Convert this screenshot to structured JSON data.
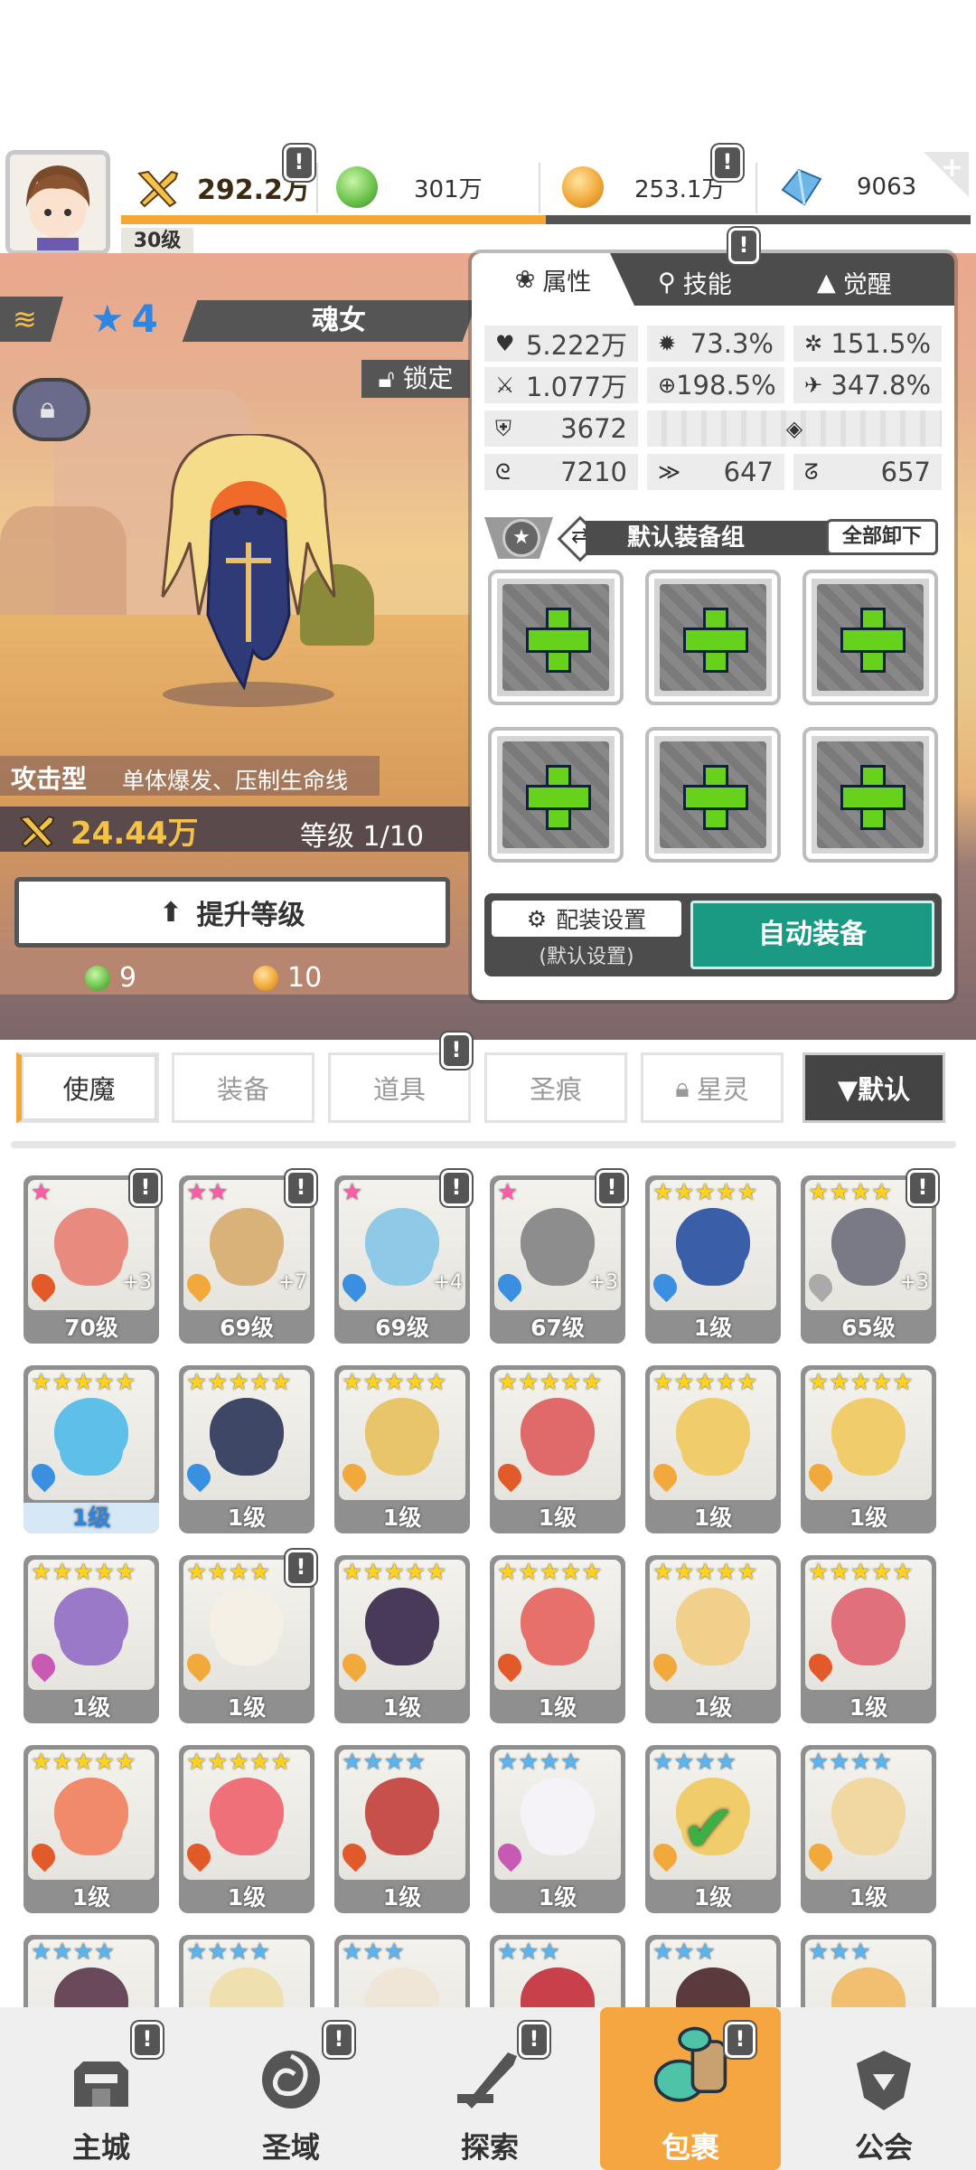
{
  "header": {
    "player_level": "30级",
    "power": "292.2万",
    "currencies": [
      {
        "name": "green-orb",
        "value": "301万",
        "color": "#6fc54f"
      },
      {
        "name": "gold-coin",
        "value": "253.1万",
        "color": "#f2a93b"
      },
      {
        "name": "blue-gem",
        "value": "9063",
        "color": "#6cb7e8"
      }
    ],
    "xp_progress": 0.5,
    "alert_mark": "!"
  },
  "hero": {
    "star_level": "4",
    "name": "魂女",
    "lock_label": "锁定",
    "type": "攻击型",
    "type_desc": "单体爆发、压制生命线",
    "power": "24.44万",
    "level": "等级 1/10",
    "upgrade_label": "提升等级",
    "costs": [
      {
        "value": "9",
        "color": "#6fc54f"
      },
      {
        "value": "10",
        "color": "#f2a93b"
      }
    ]
  },
  "panel": {
    "tabs": [
      "属性",
      "技能",
      "觉醒"
    ],
    "stats": [
      [
        "5.222万",
        "73.3%",
        "151.5%"
      ],
      [
        "1.077万",
        "198.5%",
        "347.8%"
      ],
      [
        "3672"
      ],
      [
        "7210",
        "647",
        "657"
      ]
    ],
    "equip_group": "默认装备组",
    "unequip_all": "全部卸下",
    "config_label": "配装设置",
    "config_sub": "(默认设置)",
    "auto_equip": "自动装备"
  },
  "tabs": {
    "items": [
      "使魔",
      "装备",
      "道具",
      "圣痕",
      "星灵"
    ],
    "sort": "▼默认"
  },
  "heroes": [
    {
      "stars": "★",
      "star_color": "#ff5ba8",
      "level": "70级",
      "plus": "+3",
      "palette": "#e98a7e",
      "elem": "#e35a2a",
      "alert": true
    },
    {
      "stars": "★★",
      "star_color": "#ff5ba8",
      "level": "69级",
      "plus": "+7",
      "palette": "#d9b27a",
      "elem": "#f2a93b",
      "alert": true
    },
    {
      "stars": "★",
      "star_color": "#ff5ba8",
      "level": "69级",
      "plus": "+4",
      "palette": "#8fc9e8",
      "elem": "#3b8fe0",
      "alert": true
    },
    {
      "stars": "★",
      "star_color": "#ff5ba8",
      "level": "67级",
      "plus": "+3",
      "palette": "#8d8d8d",
      "elem": "#3b8fe0",
      "alert": true
    },
    {
      "stars": "★★★★★",
      "star_color": "#ffd21f",
      "level": "1级",
      "plus": "",
      "palette": "#3a5ea8",
      "elem": "#3b8fe0",
      "alert": false
    },
    {
      "stars": "★★★★",
      "star_color": "#ffd21f",
      "level": "65级",
      "plus": "+3",
      "palette": "#7a7a86",
      "elem": "#aaaaaa",
      "alert": true
    },
    {
      "stars": "★★★★★",
      "star_color": "#ffd21f",
      "level": "1级",
      "plus": "",
      "palette": "#5ec0e8",
      "elem": "#3b8fe0",
      "alert": false,
      "level_color": "#2f86e0"
    },
    {
      "stars": "★★★★★",
      "star_color": "#ffd21f",
      "level": "1级",
      "plus": "",
      "palette": "#3f4766",
      "elem": "#3b8fe0",
      "alert": false
    },
    {
      "stars": "★★★★★",
      "star_color": "#ffd21f",
      "level": "1级",
      "plus": "",
      "palette": "#e8c46a",
      "elem": "#f2a93b",
      "alert": false
    },
    {
      "stars": "★★★★★",
      "star_color": "#ffd21f",
      "level": "1级",
      "plus": "",
      "palette": "#e06a6a",
      "elem": "#e35a2a",
      "alert": false
    },
    {
      "stars": "★★★★★",
      "star_color": "#ffd21f",
      "level": "1级",
      "plus": "",
      "palette": "#f0cc6a",
      "elem": "#f2a93b",
      "alert": false
    },
    {
      "stars": "★★★★★",
      "star_color": "#ffd21f",
      "level": "1级",
      "plus": "",
      "palette": "#f0cc6a",
      "elem": "#f2a93b",
      "alert": false
    },
    {
      "stars": "★★★★★",
      "star_color": "#ffd21f",
      "level": "1级",
      "plus": "",
      "palette": "#9a7ac8",
      "elem": "#c85ab4",
      "alert": false
    },
    {
      "stars": "★★★★",
      "star_color": "#ffd21f",
      "level": "1级",
      "plus": "",
      "palette": "#f5f0e6",
      "elem": "#f2a93b",
      "alert": true
    },
    {
      "stars": "★★★★★",
      "star_color": "#ffd21f",
      "level": "1级",
      "plus": "",
      "palette": "#4a3a5a",
      "elem": "#f2a93b",
      "alert": false
    },
    {
      "stars": "★★★★★",
      "star_color": "#ffd21f",
      "level": "1级",
      "plus": "",
      "palette": "#e8706a",
      "elem": "#e35a2a",
      "alert": false
    },
    {
      "stars": "★★★★★",
      "star_color": "#ffd21f",
      "level": "1级",
      "plus": "",
      "palette": "#f0d08a",
      "elem": "#f2a93b",
      "alert": false
    },
    {
      "stars": "★★★★★",
      "star_color": "#ffd21f",
      "level": "1级",
      "plus": "",
      "palette": "#e0707a",
      "elem": "#e35a2a",
      "alert": false
    },
    {
      "stars": "★★★★★",
      "star_color": "#ffd21f",
      "level": "1级",
      "plus": "",
      "palette": "#f08a6a",
      "elem": "#e35a2a",
      "alert": false
    },
    {
      "stars": "★★★★★",
      "star_color": "#ffd21f",
      "level": "1级",
      "plus": "",
      "palette": "#f0707a",
      "elem": "#e35a2a",
      "alert": false
    },
    {
      "stars": "★★★★",
      "star_color": "#5ab4f0",
      "level": "1级",
      "plus": "",
      "palette": "#c8504a",
      "elem": "#e35a2a",
      "alert": false
    },
    {
      "stars": "★★★★",
      "star_color": "#5ab4f0",
      "level": "1级",
      "plus": "",
      "palette": "#f5f2f8",
      "elem": "#c85ab4",
      "alert": false
    },
    {
      "stars": "★★★★",
      "star_color": "#5ab4f0",
      "level": "1级",
      "plus": "",
      "palette": "#f0cc6a",
      "elem": "#f2a93b",
      "alert": false,
      "checked": true
    },
    {
      "stars": "★★★★",
      "star_color": "#5ab4f0",
      "level": "1级",
      "plus": "",
      "palette": "#f0d8a0",
      "elem": "#f2a93b",
      "alert": false
    },
    {
      "stars": "★★★★",
      "star_color": "#5ab4f0",
      "level": "",
      "plus": "",
      "palette": "#6a4a5a",
      "elem": "",
      "alert": false
    },
    {
      "stars": "★★★★",
      "star_color": "#5ab4f0",
      "level": "",
      "plus": "",
      "palette": "#f0e0b0",
      "elem": "",
      "alert": false
    },
    {
      "stars": "★★★",
      "star_color": "#5ab4f0",
      "level": "",
      "plus": "",
      "palette": "#f0e6d8",
      "elem": "",
      "alert": false
    },
    {
      "stars": "★★★",
      "star_color": "#5ab4f0",
      "level": "",
      "plus": "",
      "palette": "#c8404a",
      "elem": "",
      "alert": false
    },
    {
      "stars": "★★★",
      "star_color": "#5ab4f0",
      "level": "",
      "plus": "",
      "palette": "#5a3a3a",
      "elem": "",
      "alert": false
    },
    {
      "stars": "★★★",
      "star_color": "#5ab4f0",
      "level": "",
      "plus": "",
      "palette": "#f0c070",
      "elem": "",
      "alert": false
    }
  ],
  "nav": [
    {
      "label": "主城",
      "icon": "castle-icon",
      "alert": true
    },
    {
      "label": "圣域",
      "icon": "vortex-icon",
      "alert": true
    },
    {
      "label": "探索",
      "icon": "sword-icon",
      "alert": true
    },
    {
      "label": "包裹",
      "icon": "bag-icon",
      "alert": true,
      "active": true
    },
    {
      "label": "公会",
      "icon": "guild-icon",
      "alert": false
    }
  ]
}
